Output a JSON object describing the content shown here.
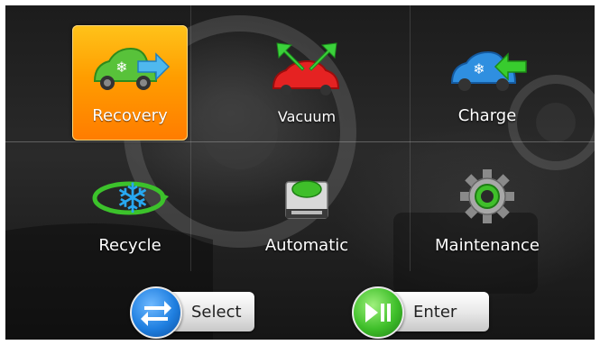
{
  "tiles": [
    {
      "id": "recovery",
      "label": "Recovery",
      "selected": true,
      "icon": "car-blue-arrow-out-icon"
    },
    {
      "id": "vacuum",
      "label": "Vacuum",
      "selected": false,
      "icon": "car-red-arrows-up-icon"
    },
    {
      "id": "charge",
      "label": "Charge",
      "selected": false,
      "icon": "car-blue-arrow-in-icon"
    },
    {
      "id": "recycle",
      "label": "Recycle",
      "selected": false,
      "icon": "snowflake-cycle-icon"
    },
    {
      "id": "automatic",
      "label": "Automatic",
      "selected": false,
      "icon": "machine-green-button-icon"
    },
    {
      "id": "maintenance",
      "label": "Maintenance",
      "selected": false,
      "icon": "gear-green-icon"
    }
  ],
  "buttons": {
    "select_label": "Select",
    "enter_label": "Enter"
  },
  "colors": {
    "selected_tile": "#ff9d00",
    "select_disc": "#1f7fe0",
    "enter_disc": "#3fbf2a"
  }
}
